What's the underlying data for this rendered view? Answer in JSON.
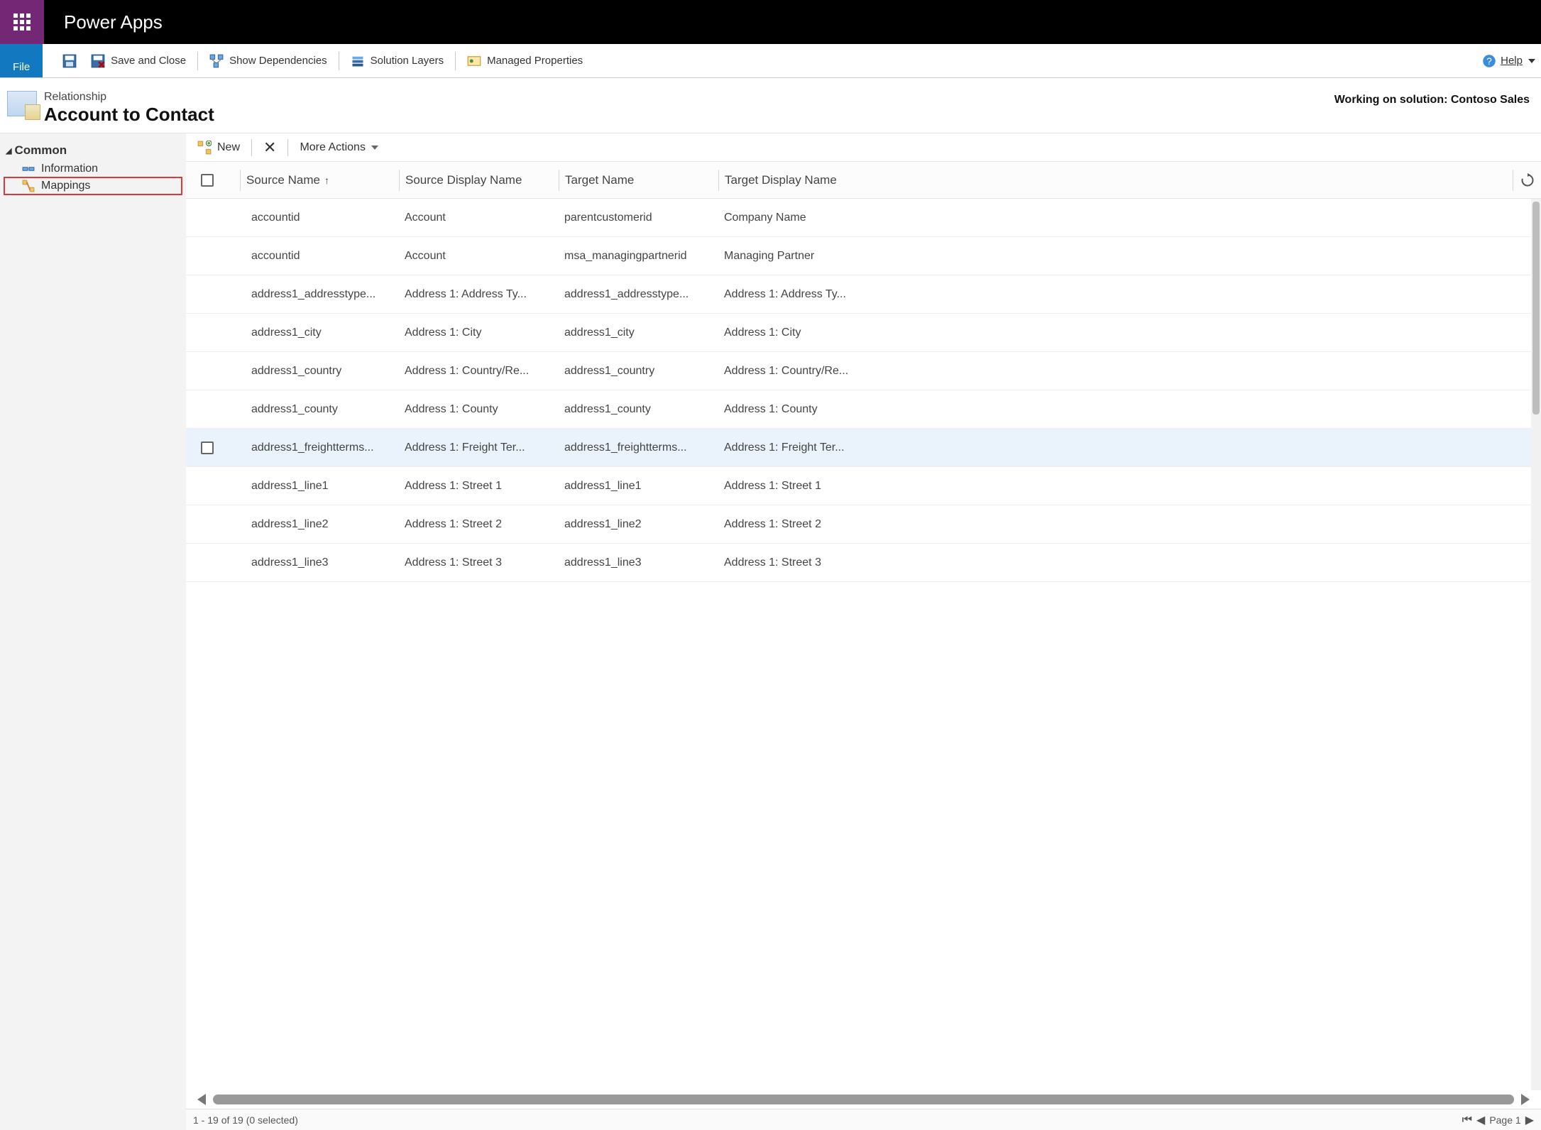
{
  "header": {
    "app_title": "Power Apps"
  },
  "ribbon": {
    "file": "File",
    "save_close": "Save and Close",
    "show_deps": "Show Dependencies",
    "solution_layers": "Solution Layers",
    "managed_props": "Managed Properties",
    "help": "Help"
  },
  "page": {
    "subtitle": "Relationship",
    "title": "Account to Contact",
    "solution_prefix": "Working on solution: ",
    "solution_name": "Contoso Sales"
  },
  "nav": {
    "group": "Common",
    "items": [
      "Information",
      "Mappings"
    ]
  },
  "toolbar": {
    "new": "New",
    "more_actions": "More Actions"
  },
  "columns": {
    "source_name": "Source Name",
    "source_display": "Source Display Name",
    "target_name": "Target Name",
    "target_display": "Target Display Name"
  },
  "rows": [
    {
      "sn": "accountid",
      "sd": "Account",
      "tn": "parentcustomerid",
      "td": "Company Name"
    },
    {
      "sn": "accountid",
      "sd": "Account",
      "tn": "msa_managingpartnerid",
      "td": "Managing Partner"
    },
    {
      "sn": "address1_addresstype...",
      "sd": "Address 1: Address Ty...",
      "tn": "address1_addresstype...",
      "td": "Address 1: Address Ty..."
    },
    {
      "sn": "address1_city",
      "sd": "Address 1: City",
      "tn": "address1_city",
      "td": "Address 1: City"
    },
    {
      "sn": "address1_country",
      "sd": "Address 1: Country/Re...",
      "tn": "address1_country",
      "td": "Address 1: Country/Re..."
    },
    {
      "sn": "address1_county",
      "sd": "Address 1: County",
      "tn": "address1_county",
      "td": "Address 1: County"
    },
    {
      "sn": "address1_freightterms...",
      "sd": "Address 1: Freight Ter...",
      "tn": "address1_freightterms...",
      "td": "Address 1: Freight Ter...",
      "hover": true
    },
    {
      "sn": "address1_line1",
      "sd": "Address 1: Street 1",
      "tn": "address1_line1",
      "td": "Address 1: Street 1"
    },
    {
      "sn": "address1_line2",
      "sd": "Address 1: Street 2",
      "tn": "address1_line2",
      "td": "Address 1: Street 2"
    },
    {
      "sn": "address1_line3",
      "sd": "Address 1: Street 3",
      "tn": "address1_line3",
      "td": "Address 1: Street 3"
    }
  ],
  "status": {
    "range": "1 - 19 of 19 (0 selected)",
    "page_label": "Page 1"
  }
}
